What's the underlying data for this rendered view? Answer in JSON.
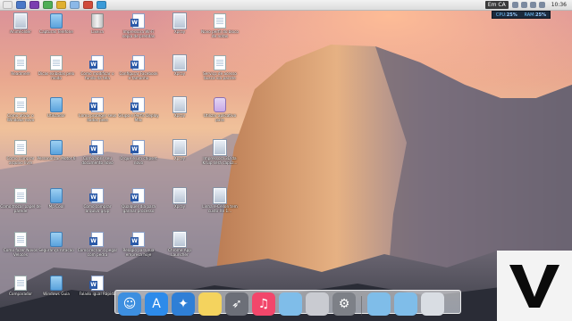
{
  "menubar": {
    "language": "Em CA",
    "time": "10:36",
    "apps": [
      {
        "name": "app-1-icon",
        "color": "#e8e8e8"
      },
      {
        "name": "app-2-icon",
        "color": "#4a78c8"
      },
      {
        "name": "app-3-icon",
        "color": "#7a3db0"
      },
      {
        "name": "app-4-icon",
        "color": "#4fae56"
      },
      {
        "name": "app-5-icon",
        "color": "#e0b030"
      },
      {
        "name": "app-6-icon",
        "color": "#8bb8e8"
      },
      {
        "name": "app-7-icon",
        "color": "#d04b3b"
      },
      {
        "name": "app-8-icon",
        "color": "#3a9ad8"
      }
    ]
  },
  "sysmon": {
    "cpu_label": "CPU:",
    "cpu_value": "25%",
    "ram_label": "RAM:",
    "ram_value": "25%"
  },
  "desktop": {
    "icons": [
      {
        "label": "AnimFolder",
        "kind": "img"
      },
      {
        "label": "Capturas Telefone",
        "kind": "folder"
      },
      {
        "label": "Lixeira",
        "kind": "trash"
      },
      {
        "label": "Impressora Wi-Fi sepia de prendas",
        "kind": "word"
      },
      {
        "label": "Xpray",
        "kind": "img"
      },
      {
        "label": "Novo perfil do bloco de notas",
        "kind": "doc"
      },
      {
        "label": "Readmem",
        "kind": "doc"
      },
      {
        "label": "Dicas exibidas pelo modo",
        "kind": "doc"
      },
      {
        "label": "Como modificar o fundo da tela",
        "kind": "word"
      },
      {
        "label": "Configurar Facebook e tamanho",
        "kind": "word"
      },
      {
        "label": "Xpray",
        "kind": "img"
      },
      {
        "label": "Serviço de acesso busca via pacote",
        "kind": "doc"
      },
      {
        "label": "Como ativar o Windows novo",
        "kind": "doc"
      },
      {
        "label": "Utilizador",
        "kind": "folder"
      },
      {
        "label": "Como proteger seus dados pess",
        "kind": "word"
      },
      {
        "label": "Grupo e Perfis Deploy Mac",
        "kind": "word"
      },
      {
        "label": "Xpray",
        "kind": "img"
      },
      {
        "label": "Utilizar aplicativo para",
        "kind": "app"
      },
      {
        "label": "Como comprar arquivo livre",
        "kind": "doc"
      },
      {
        "label": "Personalizar Motor 6",
        "kind": "folder"
      },
      {
        "label": "Como abrir seu documento novo",
        "kind": "word"
      },
      {
        "label": "O que é um chipset novo",
        "kind": "word"
      },
      {
        "label": "Xpray",
        "kind": "img"
      },
      {
        "label": "Impressora 3D da Kruip será capaz...",
        "kind": "img"
      },
      {
        "label": "Como trocar papel de parede",
        "kind": "doc"
      },
      {
        "label": "Mp Cool",
        "kind": "folder"
      },
      {
        "label": "Como comprar arquivo grup",
        "kind": "word"
      },
      {
        "label": "Qualquer dia para ganhar processo",
        "kind": "word"
      },
      {
        "label": "Xpray",
        "kind": "img"
      },
      {
        "label": "Linha e-Cellon tem custo R$ 1...",
        "kind": "img"
      },
      {
        "label": "Como fazer Novos Veloces",
        "kind": "doc"
      },
      {
        "label": "Segurança rotacao",
        "kind": "folder"
      },
      {
        "label": "Como recriar o pegar com pedra",
        "kind": "word"
      },
      {
        "label": "Relógio para sua empresa hoje",
        "kind": "word"
      },
      {
        "label": "Chrome App Launcher",
        "kind": "img"
      },
      {
        "label": "",
        "kind": "none"
      },
      {
        "label": "Comparador",
        "kind": "doc"
      },
      {
        "label": "Windows Guia",
        "kind": "folder"
      },
      {
        "label": "Falado igual Rápida",
        "kind": "word"
      },
      {
        "label": "",
        "kind": "none"
      },
      {
        "label": "",
        "kind": "none"
      },
      {
        "label": "",
        "kind": "none"
      }
    ]
  },
  "dock": {
    "items": [
      {
        "name": "finder-icon",
        "glyph": "☺",
        "bg": "#3d8fe0"
      },
      {
        "name": "app-store-icon",
        "glyph": "A",
        "bg": "#2d8bea"
      },
      {
        "name": "safari-icon",
        "glyph": "✦",
        "bg": "#2f7fd6"
      },
      {
        "name": "notes-icon",
        "glyph": "",
        "bg": "#f4d35e"
      },
      {
        "name": "launchpad-icon",
        "glyph": "➶",
        "bg": "#6c6f78"
      },
      {
        "name": "itunes-icon",
        "glyph": "♫",
        "bg": "#f2476b"
      },
      {
        "name": "folder-icon",
        "glyph": "",
        "bg": "#7fbde9"
      },
      {
        "name": "dashboard-icon",
        "glyph": "",
        "bg": "#c9cbd1"
      },
      {
        "name": "system-preferences-icon",
        "glyph": "⚙",
        "bg": "#7d8087"
      },
      {
        "name": "documents-folder-icon",
        "glyph": "",
        "bg": "#7fbde9"
      },
      {
        "name": "downloads-folder-icon",
        "glyph": "",
        "bg": "#7fbde9"
      },
      {
        "name": "trash-icon",
        "glyph": "",
        "bg": "#d9dde3"
      }
    ]
  }
}
